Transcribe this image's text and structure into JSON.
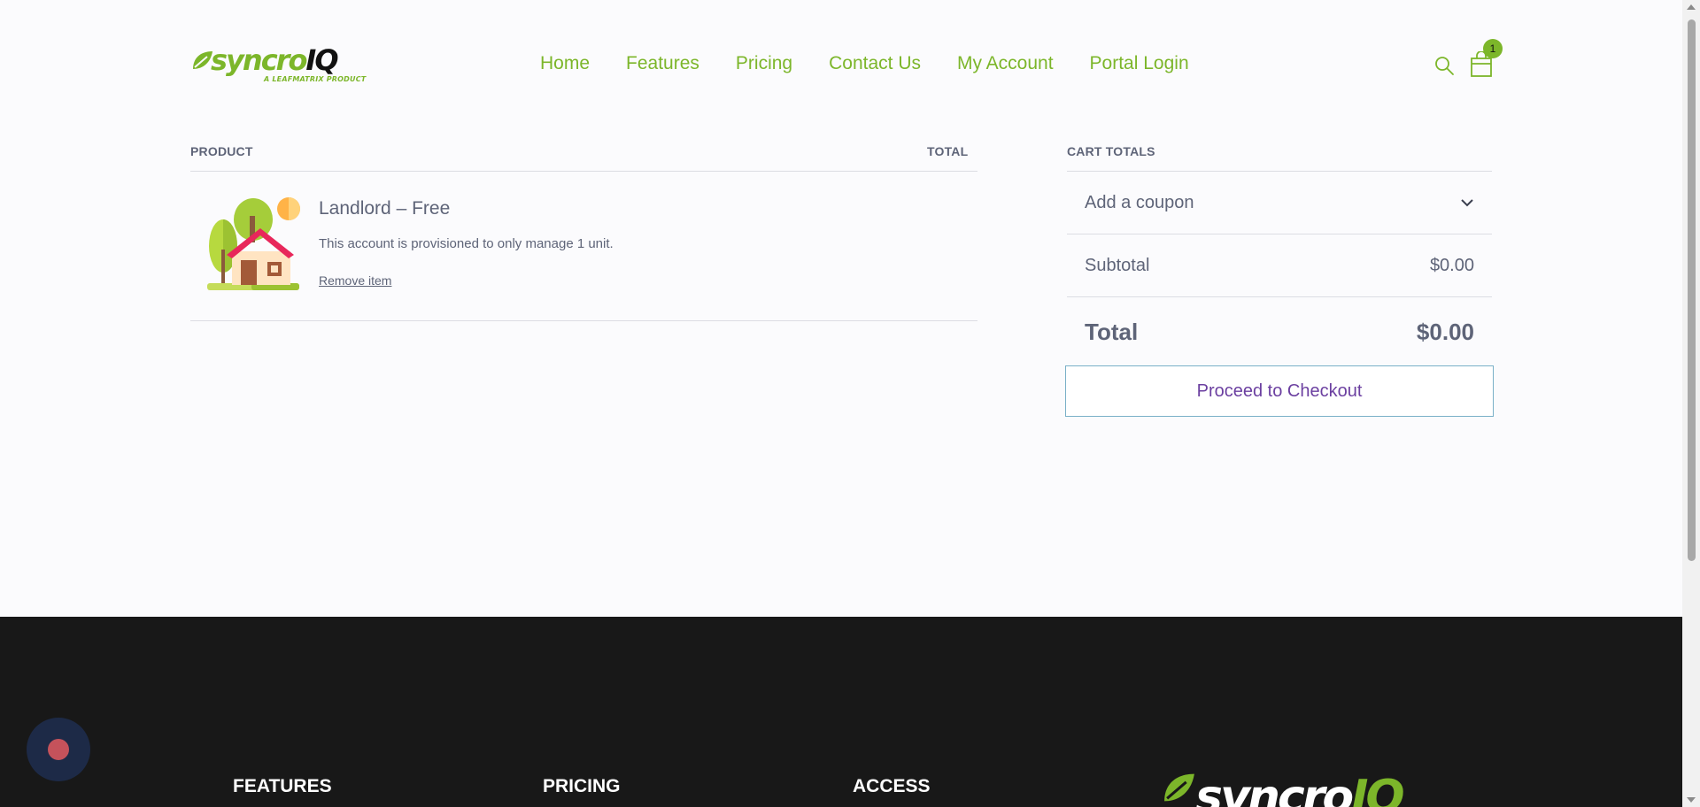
{
  "brand": {
    "name_main": "syncro",
    "name_iq": "IQ",
    "tagline": "A LEAFMATRIX PRODUCT",
    "accent_color": "#7cb62a"
  },
  "nav": {
    "items": [
      {
        "label": "Home"
      },
      {
        "label": "Features"
      },
      {
        "label": "Pricing"
      },
      {
        "label": "Contact Us"
      },
      {
        "label": "My Account"
      },
      {
        "label": "Portal Login"
      }
    ]
  },
  "header_icons": {
    "search": "search-icon",
    "cart": "cart-icon",
    "cart_count": "1"
  },
  "cart": {
    "col_product": "PRODUCT",
    "col_total": "TOTAL",
    "item": {
      "title": "Landlord – Free",
      "description": "This account is provisioned to only manage 1 unit.",
      "remove_label": "Remove item",
      "image": "house-illustration"
    }
  },
  "totals": {
    "heading": "CART TOTALS",
    "coupon_label": "Add a coupon",
    "subtotal_label": "Subtotal",
    "subtotal_value": "$0.00",
    "total_label": "Total",
    "total_value": "$0.00",
    "checkout_label": "Proceed to Checkout"
  },
  "footer": {
    "col1": "FEATURES",
    "col2": "PRICING",
    "col3": "ACCESS",
    "logo_main": "syncro",
    "logo_iq": "IQ"
  }
}
